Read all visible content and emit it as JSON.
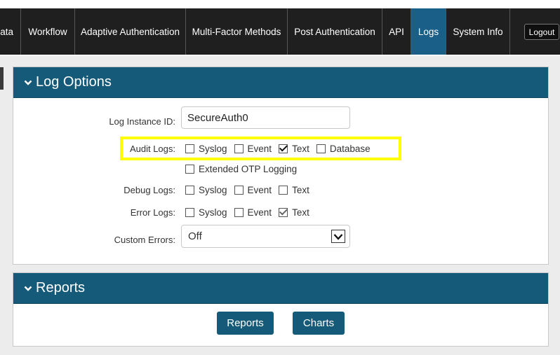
{
  "nav": {
    "items": [
      {
        "label": "Data",
        "active": false
      },
      {
        "label": "Workflow",
        "active": false
      },
      {
        "label": "Adaptive Authentication",
        "active": false
      },
      {
        "label": "Multi-Factor Methods",
        "active": false
      },
      {
        "label": "Post Authentication",
        "active": false
      },
      {
        "label": "API",
        "active": false
      },
      {
        "label": "Logs",
        "active": true
      },
      {
        "label": "System Info",
        "active": false
      }
    ],
    "logout_label": "Logout"
  },
  "log_options": {
    "title": "Log Options",
    "instance_id": {
      "label": "Log Instance ID:",
      "value": "SecureAuth0"
    },
    "audit_logs": {
      "label": "Audit Logs:",
      "options": [
        {
          "label": "Syslog",
          "checked": false
        },
        {
          "label": "Event",
          "checked": false
        },
        {
          "label": "Text",
          "checked": true
        },
        {
          "label": "Database",
          "checked": false
        }
      ]
    },
    "extended_otp": {
      "label": "Extended OTP Logging",
      "checked": false
    },
    "debug_logs": {
      "label": "Debug Logs:",
      "options": [
        {
          "label": "Syslog",
          "checked": false
        },
        {
          "label": "Event",
          "checked": false
        },
        {
          "label": "Text",
          "checked": false
        }
      ]
    },
    "error_logs": {
      "label": "Error Logs:",
      "options": [
        {
          "label": "Syslog",
          "checked": false
        },
        {
          "label": "Event",
          "checked": false
        },
        {
          "label": "Text",
          "checked": true
        }
      ]
    },
    "custom_errors": {
      "label": "Custom Errors:",
      "value": "Off"
    }
  },
  "reports": {
    "title": "Reports",
    "reports_button": "Reports",
    "charts_button": "Charts"
  },
  "colors": {
    "accent": "#155a78",
    "nav_bg": "#1f1f1f",
    "highlight": "#ffff00"
  }
}
